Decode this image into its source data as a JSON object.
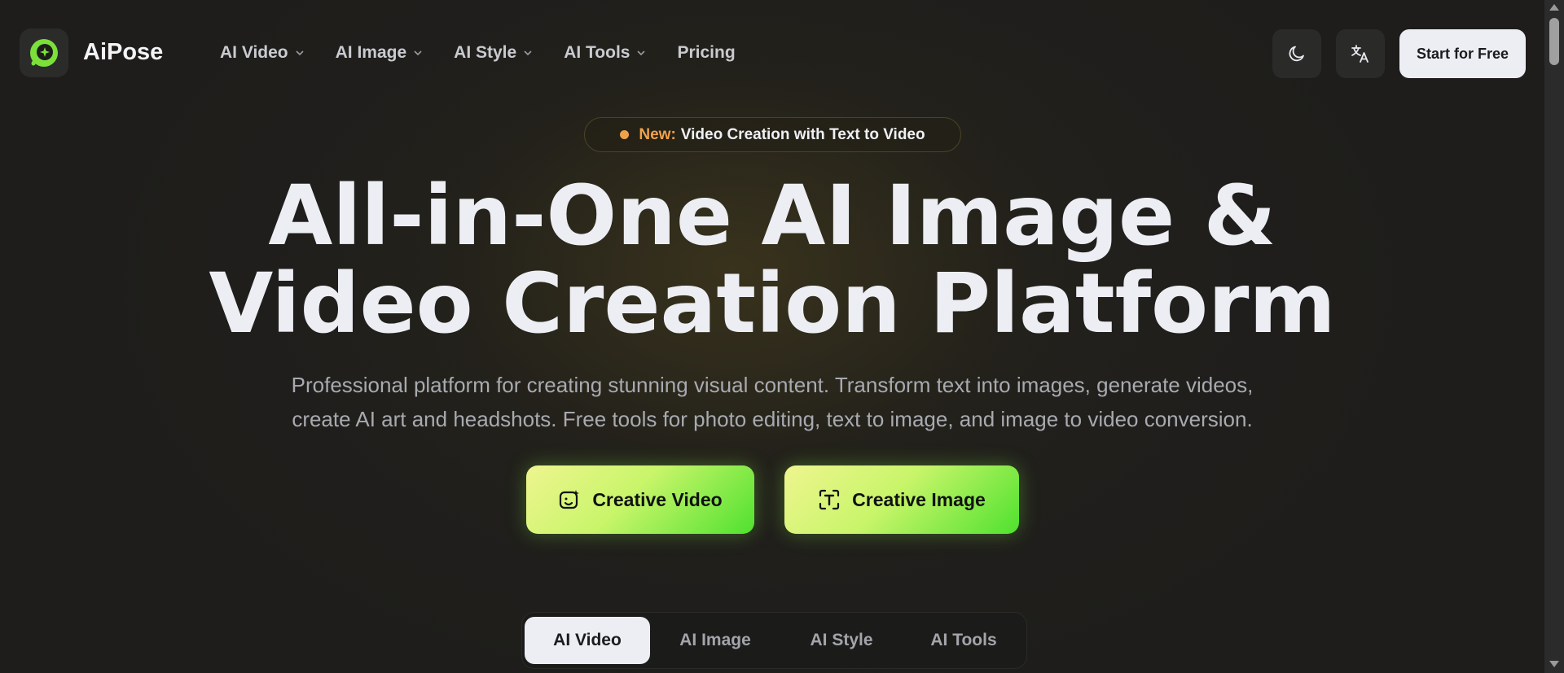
{
  "brand": {
    "name": "AiPose",
    "accent": "#7be03a"
  },
  "nav": {
    "items": [
      {
        "label": "AI Video",
        "has_dropdown": true
      },
      {
        "label": "AI Image",
        "has_dropdown": true
      },
      {
        "label": "AI Style",
        "has_dropdown": true
      },
      {
        "label": "AI Tools",
        "has_dropdown": true
      },
      {
        "label": "Pricing",
        "has_dropdown": false
      }
    ]
  },
  "header": {
    "theme_icon": "moon-icon",
    "language_icon": "translate-icon",
    "start_label": "Start for Free"
  },
  "badge": {
    "new_label": "New:",
    "text": "Video Creation with Text to Video",
    "color": "#f0a24a"
  },
  "hero": {
    "title_line1": "All-in-One AI Image &",
    "title_line2": "Video Creation Platform",
    "subtitle_line1": "Professional platform for creating stunning visual content. Transform text into images, generate videos,",
    "subtitle_line2": "create AI art and headshots. Free tools for photo editing, text to image, and image to video conversion."
  },
  "cta": {
    "video_label": "Creative Video",
    "video_icon": "video-sparkle-icon",
    "image_label": "Creative Image",
    "image_icon": "text-image-icon"
  },
  "tabs": {
    "items": [
      "AI Video",
      "AI Image",
      "AI Style",
      "AI Tools"
    ],
    "active": "AI Video"
  }
}
